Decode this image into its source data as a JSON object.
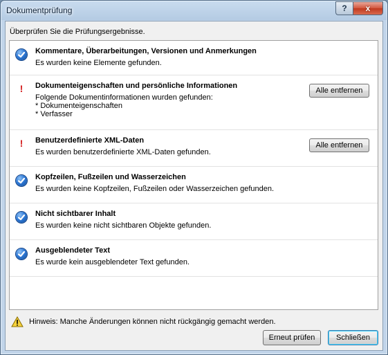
{
  "window": {
    "title": "Dokumentprüfung",
    "help_label": "?",
    "close_label": "x"
  },
  "instruction": "Überprüfen Sie die Prüfungsergebnisse.",
  "results": [
    {
      "status": "ok",
      "icon": "check-circle-icon",
      "heading": "Kommentare, Überarbeitungen, Versionen und Anmerkungen",
      "lines": [
        "Es wurden keine Elemente gefunden."
      ]
    },
    {
      "status": "warning",
      "icon": "exclamation-icon",
      "heading": "Dokumenteigenschaften und persönliche Informationen",
      "lines": [
        "Folgende Dokumentinformationen wurden gefunden:",
        "* Dokumenteigenschaften",
        "* Verfasser"
      ],
      "action_label": "Alle entfernen"
    },
    {
      "status": "warning",
      "icon": "exclamation-icon",
      "heading": "Benutzerdefinierte XML-Daten",
      "lines": [
        "Es wurden benutzerdefinierte XML-Daten gefunden."
      ],
      "action_label": "Alle entfernen"
    },
    {
      "status": "ok",
      "icon": "check-circle-icon",
      "heading": "Kopfzeilen, Fußzeilen und Wasserzeichen",
      "lines": [
        "Es wurden keine Kopfzeilen, Fußzeilen oder Wasserzeichen gefunden."
      ]
    },
    {
      "status": "ok",
      "icon": "check-circle-icon",
      "heading": "Nicht sichtbarer Inhalt",
      "lines": [
        "Es wurden keine nicht sichtbaren Objekte gefunden."
      ]
    },
    {
      "status": "ok",
      "icon": "check-circle-icon",
      "heading": "Ausgeblendeter Text",
      "lines": [
        "Es wurde kein ausgeblendeter Text gefunden."
      ]
    }
  ],
  "hint": {
    "icon": "warning-triangle-icon",
    "text": "Hinweis: Manche Änderungen können nicht rückgängig gemacht werden."
  },
  "buttons": {
    "recheck_label": "Erneut prüfen",
    "close_label": "Schließen"
  },
  "colors": {
    "check_blue": "#2f79d6",
    "warning_red": "#d41d1d",
    "warning_yellow": "#f6d23c"
  }
}
